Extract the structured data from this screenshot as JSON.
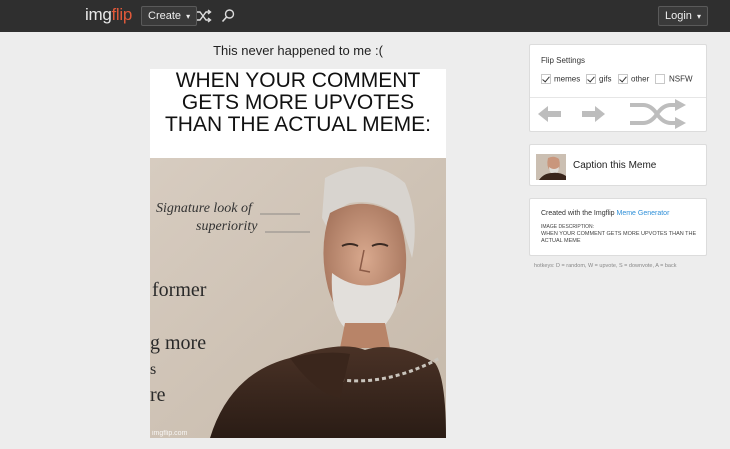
{
  "header": {
    "logo_part1": "img",
    "logo_part2": "flip",
    "create_label": "Create",
    "caret": "▾",
    "login_label": "Login",
    "icons": [
      "shuffle-icon",
      "search-icon"
    ]
  },
  "meme": {
    "title": "This never happened to me :(",
    "caption_lines": [
      "WHEN YOUR COMMENT",
      "GETS MORE UPVOTES",
      "THAN THE ACTUAL MEME:"
    ],
    "photo_text": [
      "Signature look of",
      "superiority",
      "former",
      "g more",
      "s",
      "re"
    ],
    "watermark": "imgflip.com"
  },
  "flip_settings": {
    "title": "Flip Settings",
    "options": [
      {
        "label": "memes",
        "checked": true
      },
      {
        "label": "gifs",
        "checked": true
      },
      {
        "label": "other",
        "checked": true
      },
      {
        "label": "NSFW",
        "checked": false
      }
    ],
    "buttons": [
      "back-arrow-icon",
      "forward-arrow-icon",
      "random-shuffle-icon"
    ]
  },
  "caption_panel": {
    "label": "Caption this Meme"
  },
  "info_panel": {
    "created_prefix": "Created with the Imgflip",
    "generator_link": "Meme Generator",
    "desc_heading": "IMAGE DESCRIPTION:",
    "desc_text": "WHEN YOUR COMMENT GETS MORE UPVOTES THAN THE ACTUAL MEME"
  },
  "hotkeys": "hotkeys: D = random, W = upvote, S = downvote, A = back",
  "colors": {
    "topbar": "#2f2f2f",
    "logo_accent": "#e0593a",
    "link": "#2e8fd8",
    "background": "#ededed"
  }
}
